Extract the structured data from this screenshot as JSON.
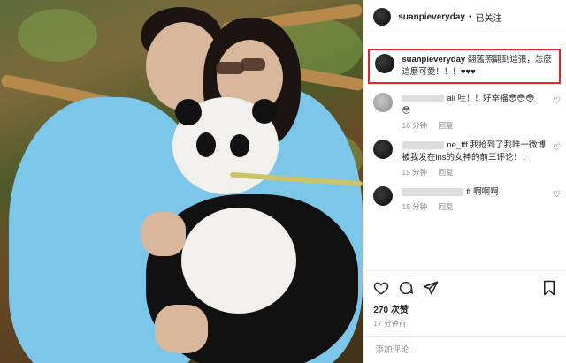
{
  "header": {
    "username": "suanpieveryday",
    "separator": "•",
    "follow_status": "已关注"
  },
  "caption": {
    "username": "suanpieveryday",
    "text": "翻舊照翻到這張，怎麼這麼可愛！！！♥♥♥"
  },
  "comments": [
    {
      "name_visible": "ali",
      "text": "哇！！好幸福😳😳😳",
      "extra_line": "😳",
      "time": "16 分钟",
      "reply": "回复"
    },
    {
      "name_visible": "ne_fff",
      "text": "我抢到了我唯一微博被我发在ins的女神的前三评论！！",
      "time": "15 分钟",
      "reply": "回复"
    },
    {
      "name_visible": "ff",
      "text": "啊啊啊",
      "time": "15 分钟",
      "reply": "回复"
    }
  ],
  "actions": {
    "likes": "270 次赞",
    "date": "17 分钟前"
  },
  "add_comment": {
    "placeholder": "添加评论..."
  }
}
